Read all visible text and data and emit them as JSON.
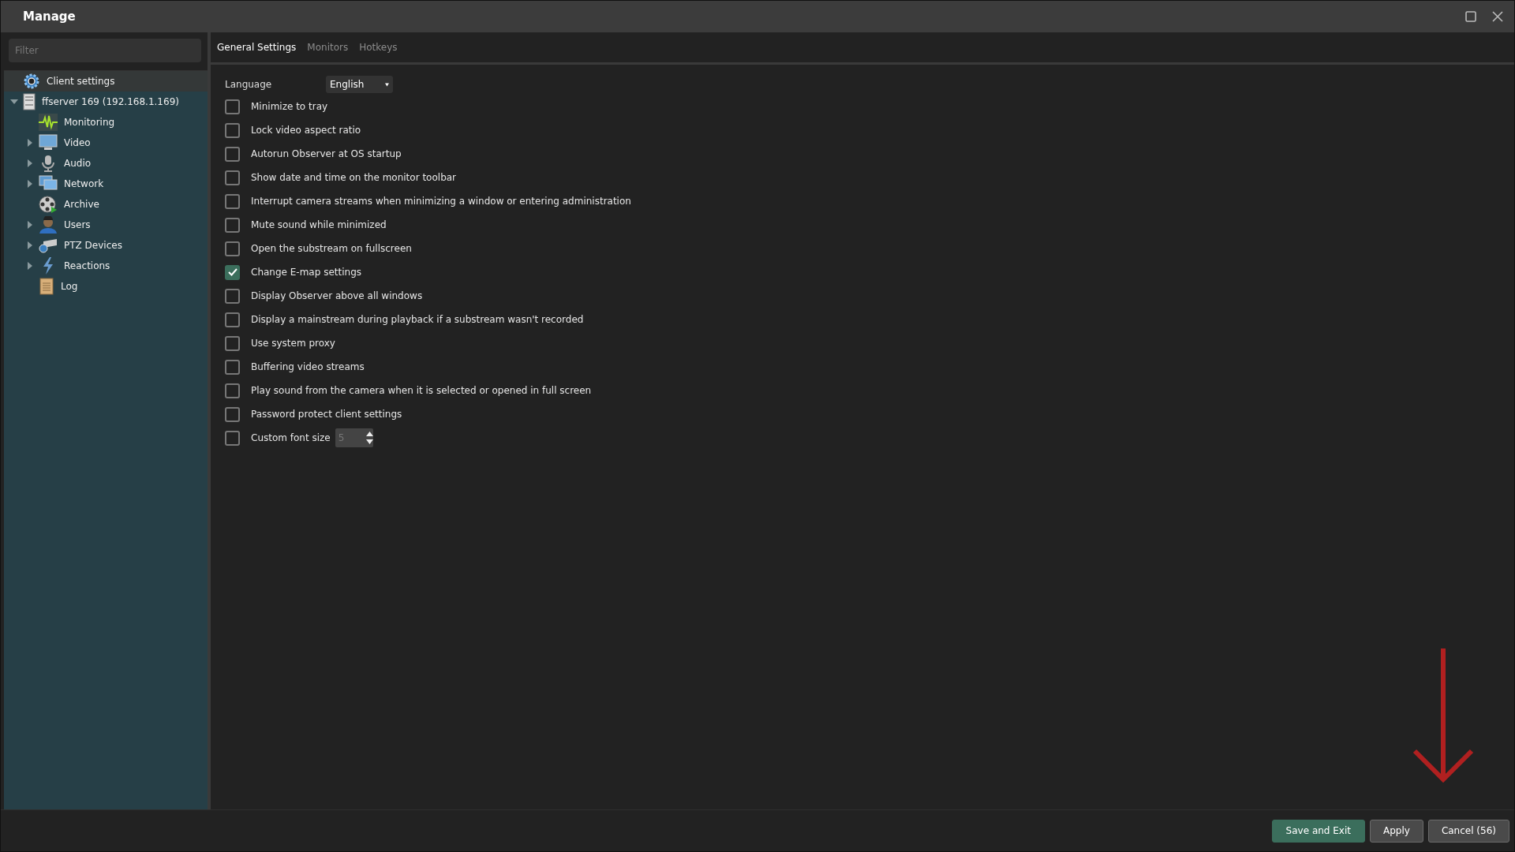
{
  "window": {
    "title": "Manage"
  },
  "sidebar": {
    "filter": {
      "placeholder": "Filter"
    },
    "tree": [
      {
        "label": "Client settings",
        "selected": true,
        "expandable": false
      },
      {
        "label": "ffserver 169 (192.168.1.169)",
        "selected": false,
        "expandable": true,
        "expanded": true,
        "children": [
          {
            "label": "Monitoring",
            "selected": false,
            "expandable": false
          },
          {
            "label": "Video",
            "selected": false,
            "expandable": true,
            "expanded": false
          },
          {
            "label": "Audio",
            "selected": false,
            "expandable": true,
            "expanded": false
          },
          {
            "label": "Network",
            "selected": false,
            "expandable": true,
            "expanded": false
          },
          {
            "label": "Archive",
            "selected": false,
            "expandable": false
          },
          {
            "label": "Users",
            "selected": false,
            "expandable": true,
            "expanded": false
          },
          {
            "label": "PTZ Devices",
            "selected": false,
            "expandable": true,
            "expanded": false
          },
          {
            "label": "Reactions",
            "selected": false,
            "expandable": true,
            "expanded": false
          },
          {
            "label": "Log",
            "selected": false,
            "expandable": false
          }
        ]
      }
    ]
  },
  "tabs": [
    {
      "label": "General Settings",
      "selected": true
    },
    {
      "label": "Monitors",
      "selected": false
    },
    {
      "label": "Hotkeys",
      "selected": false
    }
  ],
  "language": {
    "label": "Language",
    "value": "English"
  },
  "options": [
    {
      "label": "Minimize to tray",
      "checked": false
    },
    {
      "label": "Lock video aspect ratio",
      "checked": false
    },
    {
      "label": "Autorun Observer at OS startup",
      "checked": false
    },
    {
      "label": "Show date and time on the monitor toolbar",
      "checked": false
    },
    {
      "label": "Interrupt camera streams when minimizing a window or entering administration",
      "checked": false
    },
    {
      "label": "Mute sound while minimized",
      "checked": false
    },
    {
      "label": "Open the substream on fullscreen",
      "checked": false
    },
    {
      "label": "Change E-map settings",
      "checked": true
    },
    {
      "label": "Display Observer above all windows",
      "checked": false
    },
    {
      "label": "Display a mainstream during playback if a substream wasn't recorded",
      "checked": false
    },
    {
      "label": "Use system proxy",
      "checked": false
    },
    {
      "label": "Buffering video streams",
      "checked": false
    },
    {
      "label": "Play sound from the camera when it is selected or opened in full screen",
      "checked": false
    },
    {
      "label": "Password protect client settings",
      "checked": false
    },
    {
      "label": "Custom font size",
      "checked": false,
      "spinner": {
        "value": "5",
        "disabled": true
      }
    }
  ],
  "buttons": [
    {
      "label": "Save and Exit",
      "primary": true
    },
    {
      "label": "Apply",
      "primary": false
    },
    {
      "label": "Cancel (56)",
      "primary": false
    }
  ]
}
